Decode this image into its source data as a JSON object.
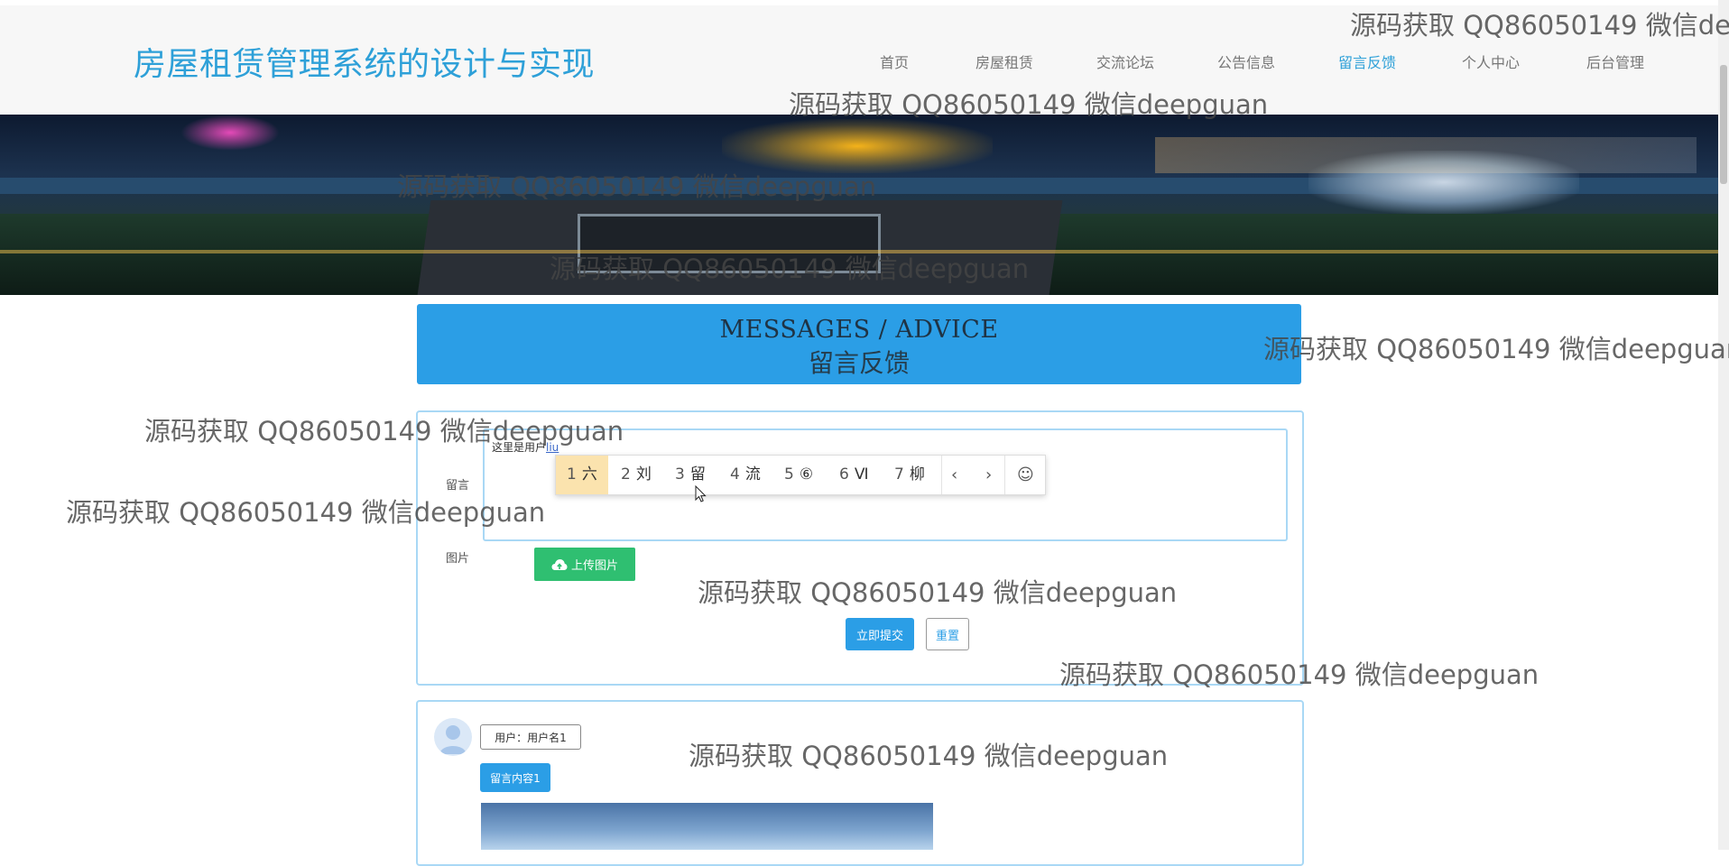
{
  "header": {
    "site_title": "房屋租赁管理系统的设计与实现",
    "nav": [
      "首页",
      "房屋租赁",
      "交流论坛",
      "公告信息",
      "留言反馈",
      "个人中心",
      "后台管理"
    ],
    "active_nav": "留言反馈"
  },
  "hero": {
    "title_en": "MESSAGES / ADVICE",
    "title_cn": "留言反馈"
  },
  "form": {
    "message_label": "留言",
    "message_prefix": "这里是用户",
    "message_typed": "liu",
    "image_label": "图片",
    "upload_label": "上传图片",
    "submit_label": "立即提交",
    "reset_label": "重置"
  },
  "ime": {
    "candidates": [
      {
        "num": "1",
        "text": "六"
      },
      {
        "num": "2",
        "text": "刘"
      },
      {
        "num": "3",
        "text": "留"
      },
      {
        "num": "4",
        "text": "流"
      },
      {
        "num": "5",
        "text": "⑥"
      },
      {
        "num": "6",
        "text": "Ⅵ"
      },
      {
        "num": "7",
        "text": "柳"
      }
    ],
    "prev": "‹",
    "next": "›",
    "emoji": "☺"
  },
  "message_list": [
    {
      "user": "用户：用户名1",
      "content": "留言内容1"
    }
  ],
  "watermark": "源码获取 QQ86050149 微信deepguan",
  "colors": {
    "accent": "#2b9ee6",
    "upload_green": "#2fbf71",
    "nav_active": "#2ea0d8"
  }
}
